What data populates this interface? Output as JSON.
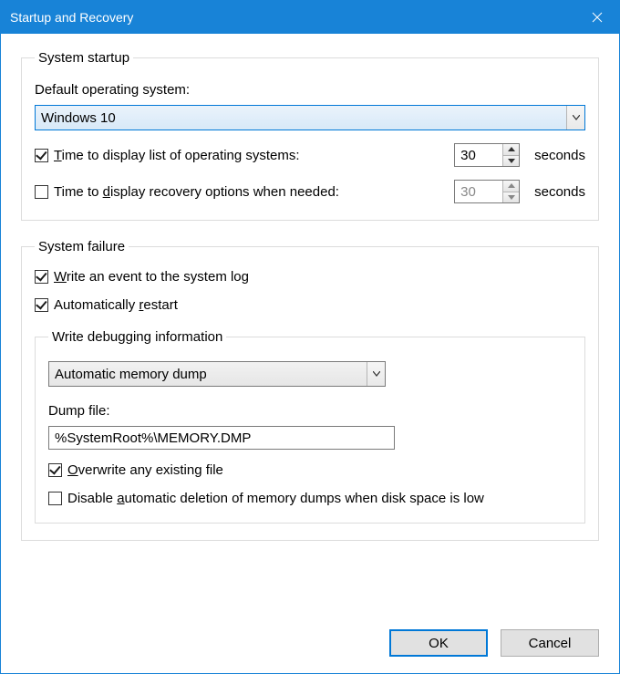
{
  "window": {
    "title": "Startup and Recovery"
  },
  "startup": {
    "legend": "System startup",
    "default_os_label": "Default operating system:",
    "default_os_value": "Windows 10",
    "time_os_list": {
      "checked": true,
      "pre": "T",
      "post": "ime to display list of operating systems:",
      "value": "30",
      "suffix": "seconds"
    },
    "time_recovery": {
      "checked": false,
      "text1": "Time to ",
      "u": "d",
      "text2": "isplay recovery options when needed:",
      "value": "30",
      "suffix": "seconds"
    }
  },
  "failure": {
    "legend": "System failure",
    "write_event": {
      "checked": true,
      "u": "W",
      "rest": "rite an event to the system log"
    },
    "auto_restart": {
      "checked": true,
      "pre": "Automatically ",
      "u": "r",
      "post": "estart"
    },
    "debug": {
      "legend": "Write debugging information",
      "dump_type": "Automatic memory dump",
      "dump_file_label": "Dump file:",
      "dump_file_value": "%SystemRoot%\\MEMORY.DMP",
      "overwrite": {
        "checked": true,
        "u": "O",
        "rest": "verwrite any existing file"
      },
      "disable_auto_delete": {
        "checked": false,
        "pre": "Disable ",
        "u": "a",
        "post": "utomatic deletion of memory dumps when disk space is low"
      }
    }
  },
  "buttons": {
    "ok": "OK",
    "cancel": "Cancel"
  }
}
